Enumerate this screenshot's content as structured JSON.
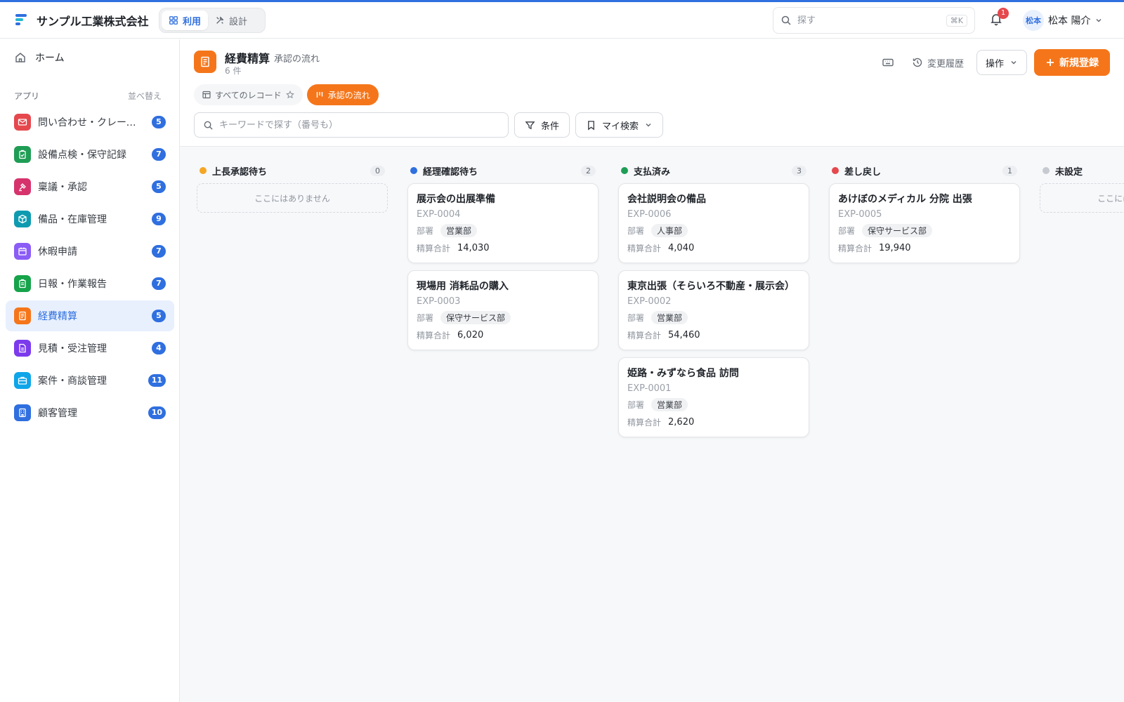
{
  "header": {
    "company": "サンプル工業株式会社",
    "modes": [
      {
        "label": "利用"
      },
      {
        "label": "設計"
      }
    ],
    "search_placeholder": "探す",
    "search_shortcut": "⌘K",
    "notification_count": "1",
    "user_avatar": "松本",
    "user_name": "松本 陽介"
  },
  "sidebar": {
    "home_label": "ホーム",
    "section_label": "アプリ",
    "sort_label": "並べ替え",
    "items": [
      {
        "label": "問い合わせ・クレーム管理",
        "count": "5",
        "color": "#e5484d"
      },
      {
        "label": "設備点検・保守記録",
        "count": "7",
        "color": "#1f9d55"
      },
      {
        "label": "稟議・承認",
        "count": "5",
        "color": "#d6336c"
      },
      {
        "label": "備品・在庫管理",
        "count": "9",
        "color": "#0e9bb0"
      },
      {
        "label": "休暇申請",
        "count": "7",
        "color": "#8b5cf6"
      },
      {
        "label": "日報・作業報告",
        "count": "7",
        "color": "#16a34a"
      },
      {
        "label": "経費精算",
        "count": "5",
        "color": "#f5761a"
      },
      {
        "label": "見積・受注管理",
        "count": "4",
        "color": "#7c3aed"
      },
      {
        "label": "案件・商談管理",
        "count": "11",
        "color": "#0ea5e9"
      },
      {
        "label": "顧客管理",
        "count": "10",
        "color": "#2f6fdf"
      }
    ]
  },
  "main": {
    "title": "経費精算",
    "view_name": "承認の流れ",
    "record_count": "6 件",
    "history_label": "変更履歴",
    "operation_label": "操作",
    "new_label": "新規登録",
    "tabs": [
      {
        "label": "すべてのレコード"
      },
      {
        "label": "承認の流れ"
      }
    ],
    "search_placeholder": "キーワードで探す（番号も）",
    "filter_label": "条件",
    "my_search_label": "マイ検索"
  },
  "board": {
    "dept_label": "部署",
    "total_label": "精算合計",
    "empty_label": "ここにはありません",
    "columns": [
      {
        "title": "上長承認待ち",
        "count": "0",
        "color": "#f5a623",
        "cards": []
      },
      {
        "title": "経理確認待ち",
        "count": "2",
        "color": "#2f6fdf",
        "cards": [
          {
            "title": "展示会の出展準備",
            "id": "EXP-0004",
            "dept": "営業部",
            "total": "14,030"
          },
          {
            "title": "現場用 消耗品の購入",
            "id": "EXP-0003",
            "dept": "保守サービス部",
            "total": "6,020"
          }
        ]
      },
      {
        "title": "支払済み",
        "count": "3",
        "color": "#1f9d55",
        "cards": [
          {
            "title": "会社説明会の備品",
            "id": "EXP-0006",
            "dept": "人事部",
            "total": "4,040"
          },
          {
            "title": "東京出張（そらいろ不動産・展示会）",
            "id": "EXP-0002",
            "dept": "営業部",
            "total": "54,460"
          },
          {
            "title": "姫路・みずなら食品 訪問",
            "id": "EXP-0001",
            "dept": "営業部",
            "total": "2,620"
          }
        ]
      },
      {
        "title": "差し戻し",
        "count": "1",
        "color": "#e5484d",
        "cards": [
          {
            "title": "あけぼのメディカル 分院 出張",
            "id": "EXP-0005",
            "dept": "保守サービス部",
            "total": "19,940"
          }
        ]
      },
      {
        "title": "未設定",
        "count": "",
        "color": "#c7cbd1",
        "cards": []
      }
    ]
  }
}
